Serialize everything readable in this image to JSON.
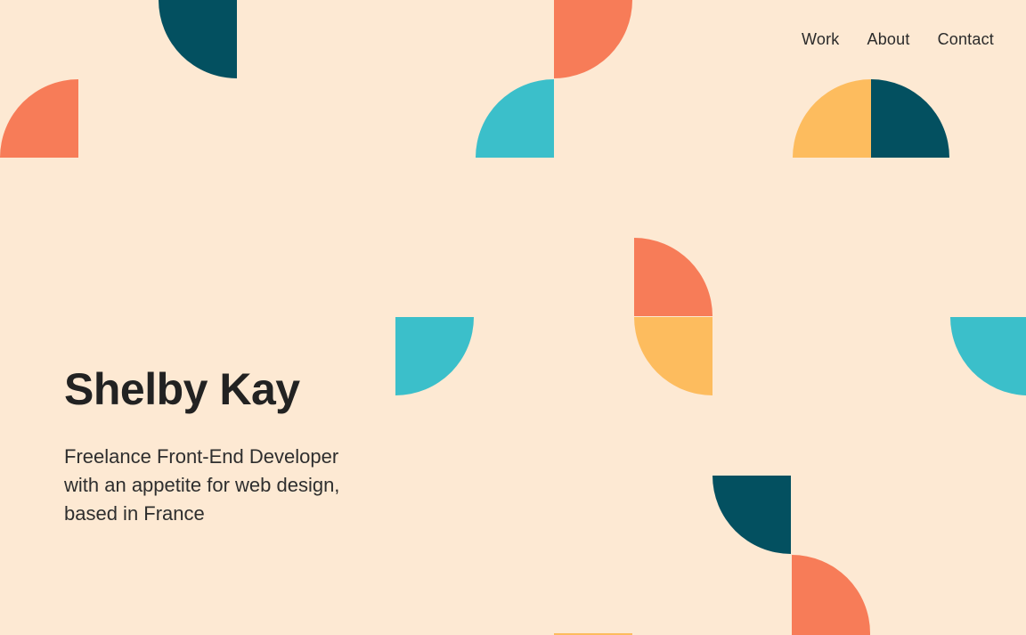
{
  "nav": {
    "items": [
      {
        "label": "Work"
      },
      {
        "label": "About"
      },
      {
        "label": "Contact"
      }
    ]
  },
  "hero": {
    "name": "Shelby Kay",
    "tagline": "Freelance Front-End Developer with an appetite for web design, based in France"
  },
  "colors": {
    "background": "#FDE9D3",
    "coral": "#F77C58",
    "teal": "#3BBFCA",
    "dark_teal": "#035060",
    "yellow": "#FDBC5E"
  }
}
